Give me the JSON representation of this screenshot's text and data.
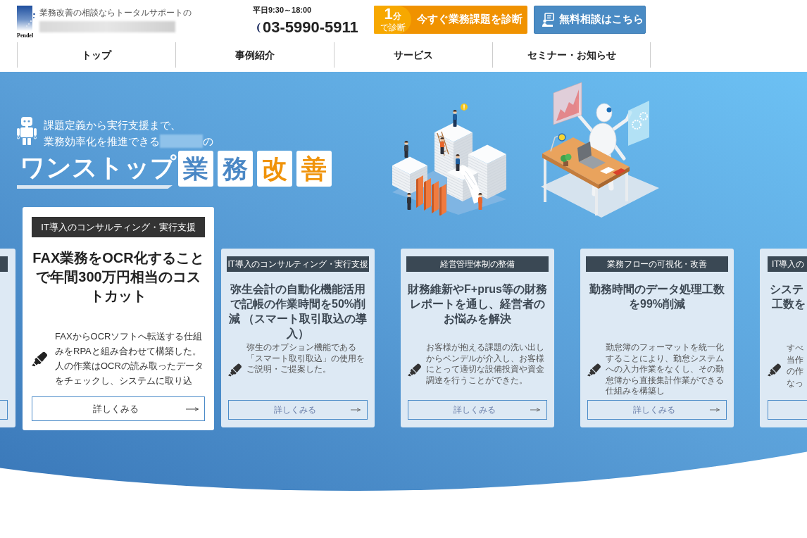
{
  "header": {
    "logo": {
      "wordmark": "Pendel",
      "tagline": "業務改善の相談ならトータルサポートの"
    },
    "hours": "平日9:30～18:00",
    "phone": "03-5990-5911",
    "diagnose_button": {
      "badge_number": "1",
      "badge_unit": "分",
      "badge_caption": "で診断",
      "label": "今すぐ業務課題を診断"
    },
    "consult_button": {
      "label": "無料相談はこちら"
    }
  },
  "nav": [
    "トップ",
    "事例紹介",
    "サービス",
    "セミナー・お知らせ"
  ],
  "hero": {
    "intro_line_1": "課題定義から実行支援まで、",
    "intro_line_2_start": "業務効率化を推進できる",
    "intro_line_2_end": "の",
    "headline": "ワンストップ",
    "tiles": [
      {
        "char": "業",
        "color": "#4a87c5"
      },
      {
        "char": "務",
        "color": "#4a87c5"
      },
      {
        "char": "改",
        "color": "#f0930a"
      },
      {
        "char": "善",
        "color": "#f0930a"
      }
    ]
  },
  "cards": [
    {
      "kind": "cut_left",
      "selected": false
    },
    {
      "kind": "full",
      "selected": true,
      "category": "IT導入のコンサルティング・実行支援",
      "title": "FAX業務をOCR化することで年間300万円相当のコストカット",
      "description": "FAXからOCRソフトへ転送する仕組みをRPAと組み合わせて構築した。人の作業はOCRの読み取ったデータをチェックし、システムに取り込",
      "link": "詳しくみる"
    },
    {
      "kind": "full",
      "selected": false,
      "category": "IT導入のコンサルティング・実行支援",
      "title": "弥生会計の自動化機能活用で記帳の作業時間を50%削減 （スマート取引取込の導入）",
      "description": "弥生のオプション機能である「スマート取引取込」の使用をご説明・ご提案した。",
      "link": "詳しくみる"
    },
    {
      "kind": "full",
      "selected": false,
      "category": "経営管理体制の整備",
      "title": "財務維新やF+prus等の財務レポートを通し、経営者のお悩みを解決",
      "description": "お客様が抱える課題の洗い出しからペンデルが介入し、お客様にとって適切な設備投資や資金調達を行うことができた。",
      "link": "詳しくみる"
    },
    {
      "kind": "full",
      "selected": false,
      "category": "業務フローの可視化・改善",
      "title": "勤務時間のデータ処理工数を99%削減",
      "description": "勤怠簿のフォーマットを統一化することにより、勤怠システムへの入力作業をなくし、その勤怠簿から直接集計作業ができる仕組みを構築し",
      "link": "詳しくみる"
    },
    {
      "kind": "cut_right",
      "selected": false,
      "category": "IT導入の",
      "title_lines": [
        "システ",
        "工数を"
      ],
      "description_lines": [
        "すべ",
        "当作",
        "の作",
        "なっ"
      ]
    }
  ]
}
